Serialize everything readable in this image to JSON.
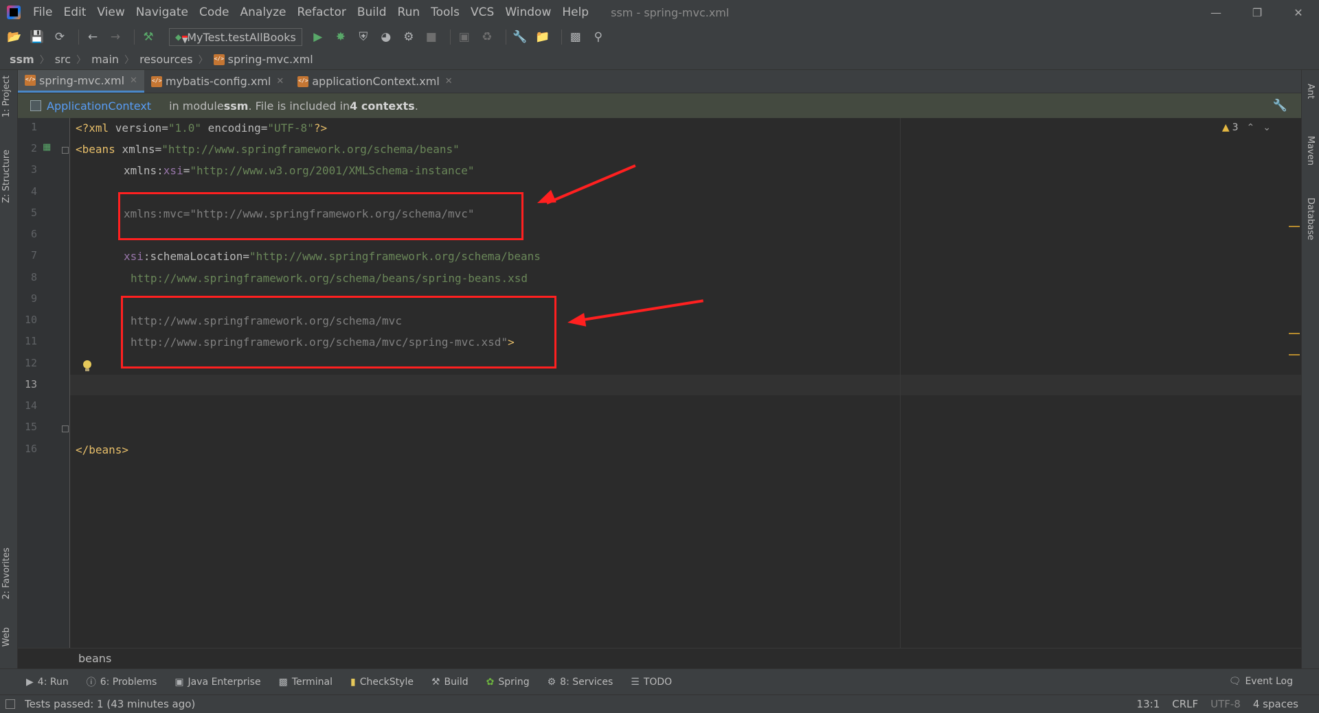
{
  "window": {
    "title": "ssm - spring-mvc.xml",
    "menu": [
      "File",
      "Edit",
      "View",
      "Navigate",
      "Code",
      "Analyze",
      "Refactor",
      "Build",
      "Run",
      "Tools",
      "VCS",
      "Window",
      "Help"
    ],
    "controls": {
      "minimize": "—",
      "restore": "❐",
      "close": "✕"
    }
  },
  "toolbar": {
    "run_config": "MyTest.testAllBooks"
  },
  "breadcrumb": [
    "ssm",
    "src",
    "main",
    "resources",
    "spring-mvc.xml"
  ],
  "left_strip": {
    "project": "1: Project",
    "structure": "Z: Structure",
    "favorites": "2: Favorites",
    "web": "Web"
  },
  "right_strip": {
    "ant": "Ant",
    "maven": "Maven",
    "database": "Database"
  },
  "tabs": [
    {
      "label": "spring-mvc.xml",
      "active": true
    },
    {
      "label": "mybatis-config.xml",
      "active": false
    },
    {
      "label": "applicationContext.xml",
      "active": false
    }
  ],
  "notice": {
    "link": "ApplicationContext",
    "text_prefix": "in module ",
    "module": "ssm",
    "text_middle": ". File is included in ",
    "contexts": "4 contexts",
    "text_suffix": "."
  },
  "editor": {
    "warning_count": "3",
    "current_line": 13,
    "line_numbers": [
      "1",
      "2",
      "3",
      "4",
      "5",
      "6",
      "7",
      "8",
      "9",
      "10",
      "11",
      "12",
      "13",
      "14",
      "15",
      "16"
    ],
    "code": {
      "l1_open": "<?xml ",
      "l1_a1": "version",
      "l1_eq1": "=",
      "l1_v1": "\"1.0\"",
      "l1_a2": " encoding",
      "l1_eq2": "=",
      "l1_v2": "\"UTF-8\"",
      "l1_close": "?>",
      "l2_tag": "<beans ",
      "l2_attr": "xmlns",
      "l2_eq": "=",
      "l2_val": "\"http://www.springframework.org/schema/beans\"",
      "l3_attr": "xmlns:",
      "l3_ns": "xsi",
      "l3_eq": "=",
      "l3_val": "\"http://www.w3.org/2001/XMLSchema-instance\"",
      "l5": "xmlns:mvc=\"http://www.springframework.org/schema/mvc\"",
      "l7_ns": "xsi",
      "l7_attr": ":schemaLocation",
      "l7_eq": "=",
      "l7_val": "\"http://www.springframework.org/schema/beans",
      "l8_val": "http://www.springframework.org/schema/beans/spring-beans.xsd",
      "l10": "http://www.springframework.org/schema/mvc",
      "l11_val": "http://www.springframework.org/schema/mvc/spring-mvc.xsd\"",
      "l11_close": ">",
      "l15": "</beans>"
    },
    "breadcrumb": "beans"
  },
  "bottom_tools": [
    {
      "label": "4: Run",
      "icon": "play-icon"
    },
    {
      "label": "6: Problems",
      "icon": "info-icon"
    },
    {
      "label": "Java Enterprise",
      "icon": "java-enterprise-icon"
    },
    {
      "label": "Terminal",
      "icon": "terminal-icon"
    },
    {
      "label": "CheckStyle",
      "icon": "checkstyle-icon"
    },
    {
      "label": "Build",
      "icon": "hammer-icon"
    },
    {
      "label": "Spring",
      "icon": "spring-icon"
    },
    {
      "label": "8: Services",
      "icon": "services-icon"
    },
    {
      "label": "TODO",
      "icon": "list-icon"
    }
  ],
  "event_log": "Event Log",
  "status": {
    "message": "Tests passed: 1 (43 minutes ago)",
    "position": "13:1",
    "line_separator": "CRLF",
    "encoding": "UTF-8",
    "indent": "4 spaces"
  },
  "colors": {
    "accent": "#4a88c7",
    "annotation_red": "#ff2020",
    "xml_tag": "#e8bf6a",
    "xml_value": "#6a8759",
    "namespace": "#9876aa"
  }
}
